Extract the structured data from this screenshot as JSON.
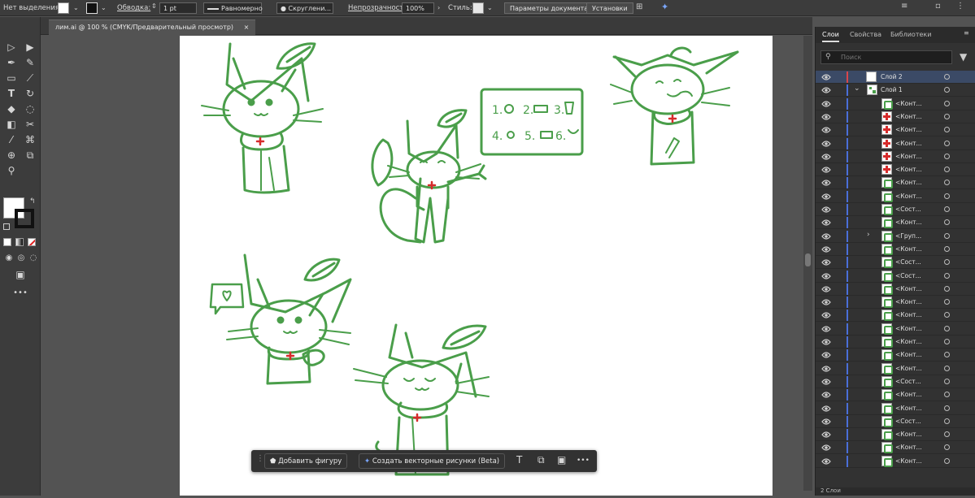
{
  "control_bar": {
    "selection": "Нет выделения",
    "stroke_label": "Обводка:",
    "stroke_weight": "1 pt",
    "stroke_profile": "Равномерно",
    "brush": "Скруглени...",
    "opacity_label": "Непрозрачность:",
    "opacity_value": "100%",
    "style_label": "Стиль:",
    "doc_setup_button": "Параметры документа",
    "preferences_button": "Установки"
  },
  "document_tab": {
    "title": "лим.ai @ 100 % (CMYK/Предварительный просмотр)",
    "close": "×"
  },
  "context_bar": {
    "add_shape": "Добавить фигуру",
    "generate_vectors": "Создать векторные рисунки (Beta)",
    "more": "•••"
  },
  "artwork": {
    "notes_board": {
      "items": [
        "1.",
        "2.",
        "3.",
        "4.",
        "5.",
        "6."
      ]
    }
  },
  "panel": {
    "tabs": [
      "Слои",
      "Свойства",
      "Библиотеки"
    ],
    "search_placeholder": "Поиск",
    "footer_label": "2 Слои",
    "layers": [
      {
        "name": "Слой 2",
        "level": 0,
        "selected": true,
        "thumb": "white"
      },
      {
        "name": "Слой 1",
        "level": 0,
        "expanded": true,
        "thumb": "art"
      },
      {
        "name": "<Конт...",
        "level": 1,
        "thumb": "green-shape"
      },
      {
        "name": "<Конт...",
        "level": 1,
        "thumb": "red-cross"
      },
      {
        "name": "<Конт...",
        "level": 1,
        "thumb": "red-cross"
      },
      {
        "name": "<Конт...",
        "level": 1,
        "thumb": "red-cross"
      },
      {
        "name": "<Конт...",
        "level": 1,
        "thumb": "red-cross"
      },
      {
        "name": "<Конт...",
        "level": 1,
        "thumb": "red-cross"
      },
      {
        "name": "<Конт...",
        "level": 1,
        "thumb": "green-shape"
      },
      {
        "name": "<Конт...",
        "level": 1,
        "thumb": "green-shape"
      },
      {
        "name": "<Сост...",
        "level": 1,
        "thumb": "green-shape"
      },
      {
        "name": "<Конт...",
        "level": 1,
        "thumb": "green-shape"
      },
      {
        "name": "<Груп...",
        "level": 1,
        "thumb": "green-shape",
        "collapsed": true
      },
      {
        "name": "<Конт...",
        "level": 1,
        "thumb": "green-shape"
      },
      {
        "name": "<Сост...",
        "level": 1,
        "thumb": "green-shape"
      },
      {
        "name": "<Сост...",
        "level": 1,
        "thumb": "green-shape"
      },
      {
        "name": "<Конт...",
        "level": 1,
        "thumb": "green-shape"
      },
      {
        "name": "<Конт...",
        "level": 1,
        "thumb": "green-shape"
      },
      {
        "name": "<Конт...",
        "level": 1,
        "thumb": "green-shape"
      },
      {
        "name": "<Конт...",
        "level": 1,
        "thumb": "green-shape"
      },
      {
        "name": "<Конт...",
        "level": 1,
        "thumb": "green-shape"
      },
      {
        "name": "<Конт...",
        "level": 1,
        "thumb": "green-shape"
      },
      {
        "name": "<Конт...",
        "level": 1,
        "thumb": "green-shape"
      },
      {
        "name": "<Сост...",
        "level": 1,
        "thumb": "green-shape"
      },
      {
        "name": "<Конт...",
        "level": 1,
        "thumb": "green-shape"
      },
      {
        "name": "<Конт...",
        "level": 1,
        "thumb": "green-shape"
      },
      {
        "name": "<Сост...",
        "level": 1,
        "thumb": "green-shape"
      },
      {
        "name": "<Конт...",
        "level": 1,
        "thumb": "green-shape"
      },
      {
        "name": "<Конт...",
        "level": 1,
        "thumb": "green-shape"
      },
      {
        "name": "<Конт...",
        "level": 1,
        "thumb": "green-shape"
      }
    ]
  },
  "colors": {
    "art_green": "#4a9e4a",
    "cross_red": "#d62b2b",
    "layer2_color": "#d9464b",
    "layer1_color": "#4a6fd9",
    "selected_row": "#3b4a66"
  }
}
